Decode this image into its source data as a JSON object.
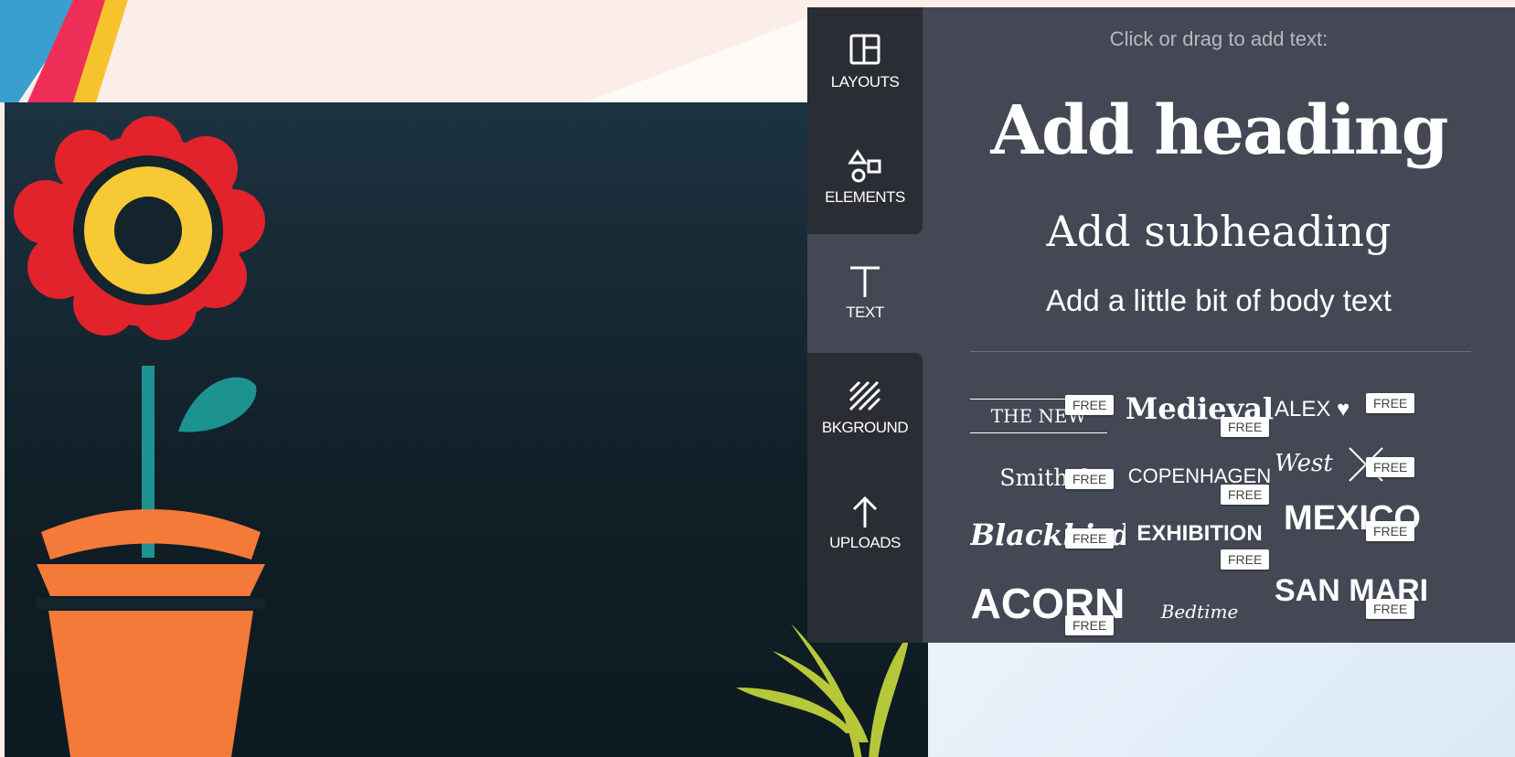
{
  "sidebar": {
    "tabs": [
      {
        "label": "LAYOUTS",
        "icon": "layouts-icon"
      },
      {
        "label": "ELEMENTS",
        "icon": "elements-icon"
      },
      {
        "label": "TEXT",
        "icon": "text-icon"
      },
      {
        "label": "BKGROUND",
        "icon": "background-icon"
      },
      {
        "label": "UPLOADS",
        "icon": "upload-arrow-icon"
      }
    ]
  },
  "text_panel": {
    "hint": "Click or drag to add text:",
    "heading": "Add heading",
    "subheading": "Add subheading",
    "body": "Add a little bit of body text",
    "badge": "FREE",
    "templates": [
      {
        "text": "THE NEW"
      },
      {
        "text": "Medieval"
      },
      {
        "text": "ALEX ♥"
      },
      {
        "text": "Smith &"
      },
      {
        "text": "COPENHAGEN"
      },
      {
        "text": "West"
      },
      {
        "text": "Blackbird"
      },
      {
        "text": "EXHIBITION"
      },
      {
        "text": "MEXICO"
      },
      {
        "text": "ACORN"
      },
      {
        "text": "Bedtime"
      },
      {
        "text": "SAN MARINO"
      }
    ]
  },
  "colors": {
    "panel_bg": "#434854",
    "sidebar_active": "#2a2d34",
    "canvas_bg": "#13242d",
    "flower_red": "#e2232b",
    "flower_yellow": "#f6c935",
    "pot_orange": "#f37a38",
    "stem_teal": "#1c9391",
    "grass_green": "#b6c83a"
  }
}
